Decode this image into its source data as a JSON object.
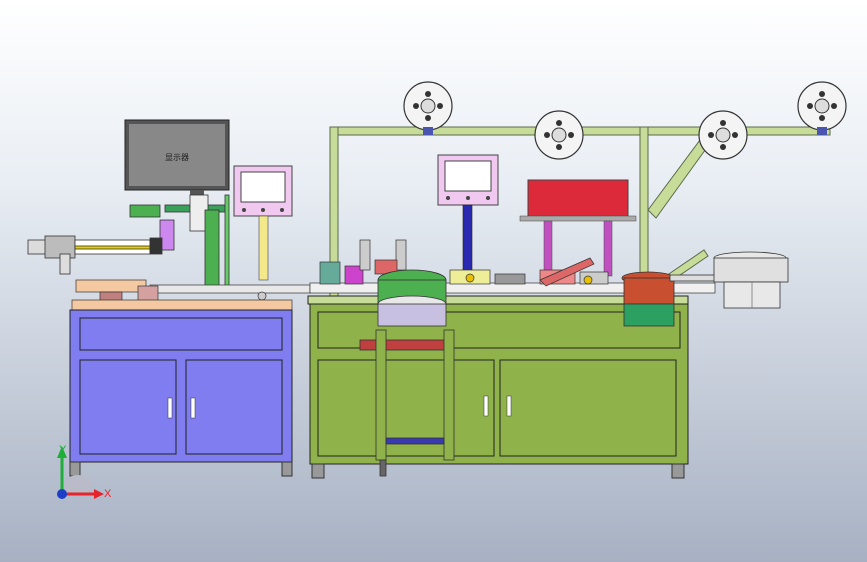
{
  "drawing": {
    "monitor_label": "显示器"
  },
  "triad": {
    "x_label": "X",
    "y_label": "Y",
    "colors": {
      "x": "#e8232a",
      "y": "#1fae3a",
      "z": "#1d3fc8"
    }
  },
  "colors": {
    "left_cabinet": "#7f7df0",
    "right_cabinet": "#8fb34a",
    "frame": "#c8dc9a",
    "monitor_housing": "#f0c8f0",
    "red_box": "#dd2a3a"
  }
}
